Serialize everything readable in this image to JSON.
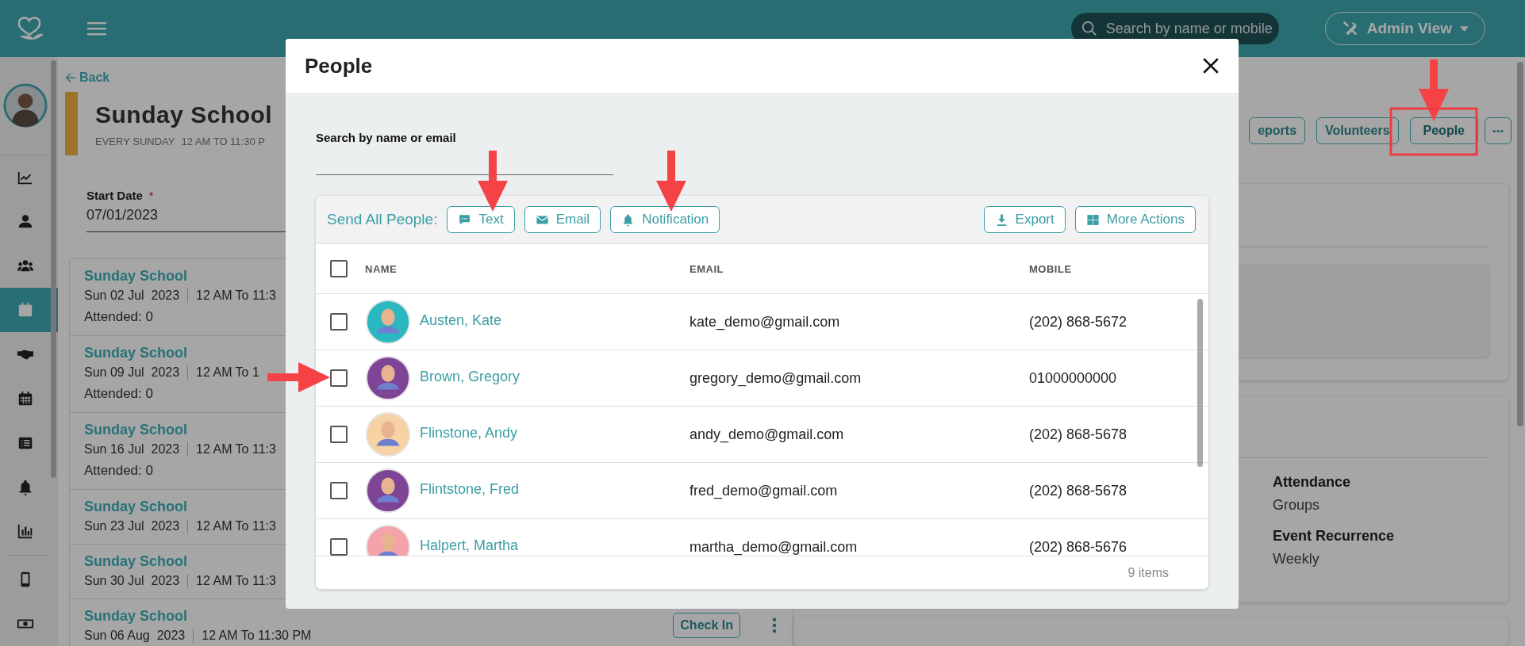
{
  "topbar": {
    "search": {
      "placeholder": "Search by name or mobile"
    },
    "view_button": "Admin View"
  },
  "sidebar": {
    "items": [
      {
        "selected": false
      },
      {
        "selected": false
      },
      {
        "selected": false
      },
      {
        "selected": true
      },
      {
        "selected": false
      },
      {
        "selected": false
      },
      {
        "selected": false
      },
      {
        "selected": false
      },
      {
        "selected": false
      },
      {
        "selected": false
      },
      {
        "selected": false
      }
    ]
  },
  "event": {
    "back": "Back",
    "title": "Sunday School",
    "recurrence": "EVERY SUNDAY",
    "time": "12 AM TO 11:30 P",
    "start_date": {
      "label": "Start Date",
      "required_mark": "*",
      "value": "07/01/2023"
    }
  },
  "occurrences": [
    {
      "title": "Sunday School",
      "date": "Sun 02 Jul  2023",
      "time": "12 AM To 11:3",
      "attended": "Attended: 0"
    },
    {
      "title": "Sunday School",
      "date": "Sun 09 Jul  2023",
      "time": "12 AM To 1",
      "attended": "Attended: 0"
    },
    {
      "title": "Sunday School",
      "date": "Sun 16 Jul  2023",
      "time": "12 AM To 11:3",
      "attended": "Attended: 0"
    },
    {
      "title": "Sunday School",
      "date": "Sun 23 Jul  2023",
      "time": "12 AM To 11:3"
    },
    {
      "title": "Sunday School",
      "date": "Sun 30 Jul  2023",
      "time": "12 AM To 11:3"
    },
    {
      "title": "Sunday School",
      "date": "Sun 06 Aug  2023",
      "time": "12 AM To 11:30 PM",
      "action": "Check In"
    }
  ],
  "actions": [
    {
      "label": "eports",
      "selected": false
    },
    {
      "label": "Volunteers",
      "selected": false
    },
    {
      "label": "People",
      "selected": true
    }
  ],
  "details": [
    {
      "label": "Attendance",
      "value": "Groups"
    },
    {
      "label": "Event Recurrence",
      "value": "Weekly"
    }
  ],
  "modal": {
    "title": "People",
    "search": {
      "label": "Search by name or email"
    },
    "send_label": "Send All People:",
    "send_buttons": [
      {
        "label": "Text"
      },
      {
        "label": "Email"
      },
      {
        "label": "Notification"
      }
    ],
    "tools": [
      {
        "label": "Export"
      },
      {
        "label": "More Actions"
      }
    ],
    "select_all": {
      "checked": false
    },
    "columns": [
      "NAME",
      "EMAIL",
      "MOBILE"
    ],
    "rows": [
      {
        "name": "Austen, Kate",
        "email": "kate_demo@gmail.com",
        "mobile": "(202) 868-5672",
        "checked": false,
        "color": "#2bb8c0"
      },
      {
        "name": "Brown, Gregory",
        "email": "gregory_demo@gmail.com",
        "mobile": "01000000000",
        "checked": false,
        "color": "#7e4597"
      },
      {
        "name": "Flinstone, Andy",
        "email": "andy_demo@gmail.com",
        "mobile": "(202) 868-5678",
        "checked": false,
        "color": "#f6d2a4"
      },
      {
        "name": "Flintstone, Fred",
        "email": "fred_demo@gmail.com",
        "mobile": "(202) 868-5678",
        "checked": false,
        "color": "#7e4597"
      },
      {
        "name": "Halpert, Martha",
        "email": "martha_demo@gmail.com",
        "mobile": "(202) 868-5676",
        "checked": false,
        "color": "#f3a3a9"
      }
    ],
    "footer": "9 items"
  }
}
